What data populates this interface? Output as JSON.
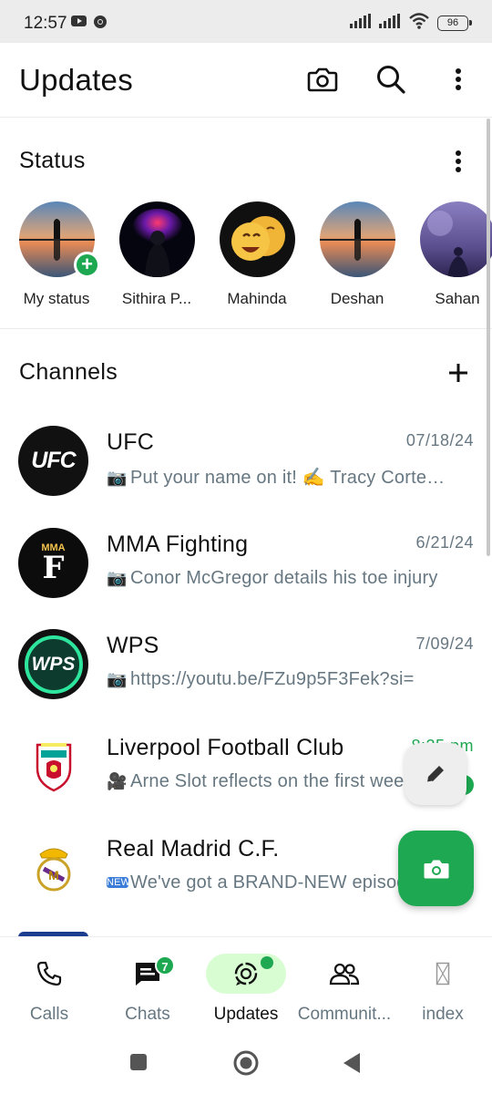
{
  "status_bar": {
    "time": "12:57",
    "battery": "96"
  },
  "header": {
    "title": "Updates",
    "icons": [
      "camera-icon",
      "search-icon",
      "more-vert-icon"
    ]
  },
  "status": {
    "title": "Status",
    "items": [
      {
        "name": "My status"
      },
      {
        "name": "Sithira P..."
      },
      {
        "name": "Mahinda"
      },
      {
        "name": "Deshan"
      },
      {
        "name": "Sahan"
      }
    ]
  },
  "channels": {
    "title": "Channels",
    "items": [
      {
        "name": "UFC",
        "date": "07/18/24",
        "preview": "Put your name on it! ✍️ Tracy Cortez, Macy Chiasson",
        "preview_icon": "photo-icon",
        "avatar_text": "UFC"
      },
      {
        "name": "MMA Fighting",
        "date": "6/21/24",
        "preview": "Conor McGregor details his toe injury",
        "preview_icon": "photo-icon",
        "avatar_text": "MMA"
      },
      {
        "name": "WPS",
        "date": "7/09/24",
        "preview": "https://youtu.be/FZu9p5F3Fek?si=",
        "preview_icon": "photo-icon",
        "avatar_text": "WPS"
      },
      {
        "name": "Liverpool Football Club",
        "date": "8:25 pm",
        "preview": "Arne Slot reflects on the first week",
        "preview_icon": "video-icon",
        "avatar_text": ""
      },
      {
        "name": "Real Madrid C.F.",
        "date": "",
        "preview": "We've got a BRAND-NEW episode",
        "preview_icon": "new-icon",
        "avatar_text": ""
      }
    ]
  },
  "bottom_nav": {
    "items": [
      {
        "label": "Calls"
      },
      {
        "label": "Chats",
        "badge": "7"
      },
      {
        "label": "Updates"
      },
      {
        "label": "Communit..."
      },
      {
        "label": "index"
      }
    ]
  },
  "colors": {
    "accent": "#1da851",
    "active_pill": "#d8fdd2",
    "secondary_text": "#667781"
  }
}
